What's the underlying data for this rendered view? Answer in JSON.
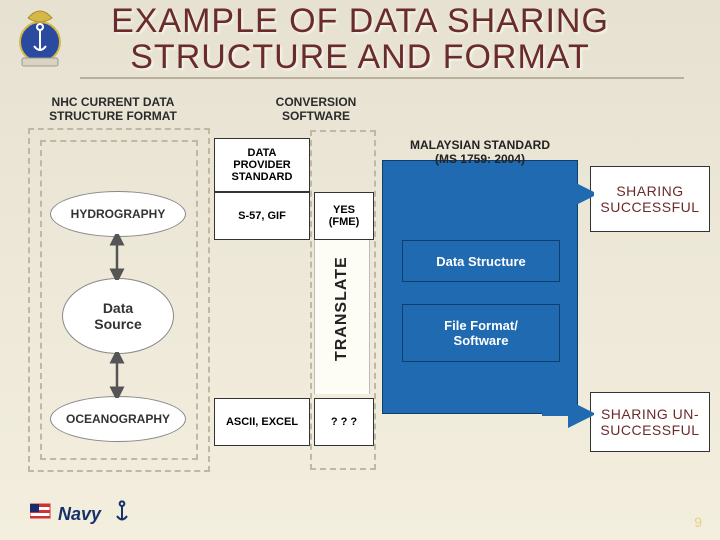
{
  "title_line1": "EXAMPLE OF DATA SHARING",
  "title_line2": "STRUCTURE AND FORMAT",
  "col1_l1": "NHC CURRENT DATA",
  "col1_l2": "STRUCTURE FORMAT",
  "col2_l1": "CONVERSION",
  "col2_l2": "SOFTWARE",
  "provider_l1": "DATA",
  "provider_l2": "PROVIDER",
  "provider_l3": "STANDARD",
  "row1_source": "HYDROGRAPHY",
  "row1_fmt": "S-57, GIF",
  "row1_conv_l1": "YES",
  "row1_conv_l2": "(FME)",
  "row2_source": "OCEANOGRAPHY",
  "row2_fmt": "ASCII, EXCEL",
  "row2_conv": "? ? ?",
  "center_label": "Data\nSource",
  "std_l1": "MALAYSIAN STANDARD",
  "std_l2": "(MS 1759: 2004)",
  "callout1": "Data Structure",
  "callout2_l1": "File Format/",
  "callout2_l2": "Software",
  "result_ok_l1": "SHARING",
  "result_ok_l2": "SUCCESSFUL",
  "result_bad_l1": "SHARING UN-",
  "result_bad_l2": "SUCCESSFUL",
  "translate": "TRANSLATE",
  "page": "9",
  "footer_brand": "Navy"
}
